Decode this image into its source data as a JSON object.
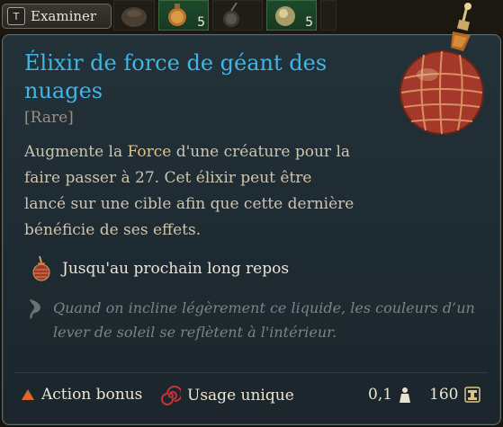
{
  "toolbar": {
    "examine_key": "T",
    "examine_label": "Examiner",
    "slot_counts": [
      "5",
      "5"
    ]
  },
  "item": {
    "name": "Élixir de force de géant des nuages",
    "rarity": "[Rare]",
    "description_before": "Augmente la ",
    "description_highlight": "Force",
    "description_after": " d'une créature pour la faire passer à 27. Cet élixir peut être lancé sur une cible afin que cette dernière bénéficie de ses effets.",
    "duration": "Jusqu'au prochain long repos",
    "flavor": "Quand on incline légèrement ce liquide, les couleurs d’un lever de soleil se reflètent à l'intérieur.",
    "action_type": "Action bonus",
    "usage": "Usage unique",
    "weight": "0,1",
    "price": "160"
  },
  "colors": {
    "title": "#3fb6e6",
    "highlight": "#e6c47a",
    "action_triangle": "#e0652a",
    "usage_icon": "#c2353a"
  },
  "icons": [
    "key-t-icon",
    "potion-item-icon",
    "leaf-icon",
    "weight-icon",
    "gold-coin-icon",
    "triangle-icon",
    "spiral-icon"
  ]
}
